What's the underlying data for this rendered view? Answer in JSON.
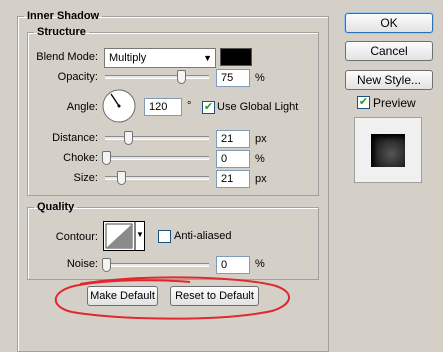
{
  "dialog": {
    "title": "Inner Shadow"
  },
  "structure": {
    "title": "Structure",
    "blend_mode": {
      "label": "Blend Mode:",
      "value": "Multiply",
      "color": "#000000"
    },
    "opacity": {
      "label": "Opacity:",
      "value": "75",
      "unit": "%",
      "level": 0.75
    },
    "angle": {
      "label": "Angle:",
      "value": "120",
      "unit": "°",
      "use_global_light": {
        "label": "Use Global Light",
        "checked": true
      }
    },
    "distance": {
      "label": "Distance:",
      "value": "21",
      "unit": "px"
    },
    "choke": {
      "label": "Choke:",
      "value": "0",
      "unit": "%"
    },
    "size": {
      "label": "Size:",
      "value": "21",
      "unit": "px"
    }
  },
  "quality": {
    "title": "Quality",
    "contour": {
      "label": "Contour:"
    },
    "anti_aliased": {
      "label": "Anti-aliased",
      "checked": false
    },
    "noise": {
      "label": "Noise:",
      "value": "0",
      "unit": "%"
    }
  },
  "buttons": {
    "make_default": "Make Default",
    "reset_default": "Reset to Default",
    "ok": "OK",
    "cancel": "Cancel",
    "new_style": "New Style..."
  },
  "preview": {
    "label": "Preview",
    "checked": true
  },
  "colors": {
    "annotation": "#e0282e",
    "field_border": "#7f9db9"
  }
}
